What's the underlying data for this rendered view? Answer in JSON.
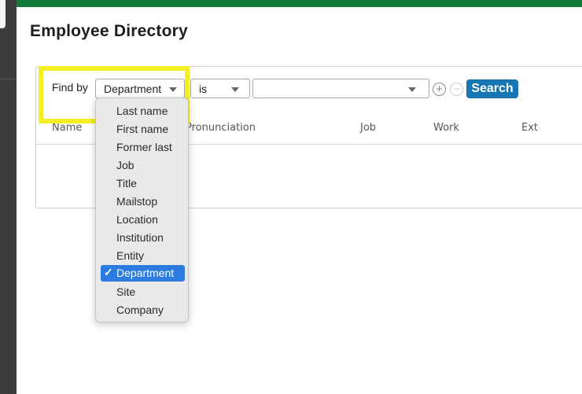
{
  "page": {
    "title": "Employee Directory"
  },
  "search": {
    "find_label": "Find by",
    "field_value": "Department",
    "operator_value": "is",
    "value_value": "",
    "plus_symbol": "+",
    "minus_symbol": "−",
    "search_label": "Search"
  },
  "table": {
    "columns": [
      "Name",
      "Pronunciation",
      "Job",
      "Work",
      "Ext"
    ]
  },
  "dropdown": {
    "options": [
      "Last name",
      "First name",
      "Former last",
      "Job",
      "Title",
      "Mailstop",
      "Location",
      "Institution",
      "Entity",
      "Department",
      "Site",
      "Company"
    ],
    "selected": "Department"
  },
  "colors": {
    "top_bar": "#0f7a3a",
    "search_button": "#1576b3",
    "highlight": "#f4ee23",
    "selected_option": "#2c7be0"
  }
}
